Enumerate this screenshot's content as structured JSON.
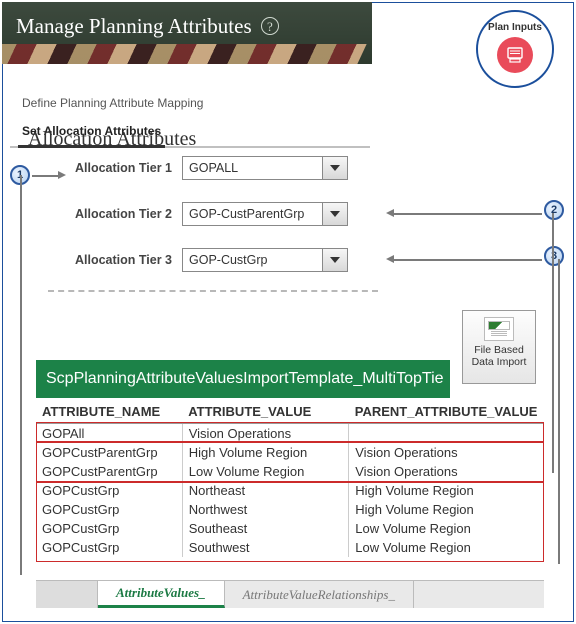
{
  "banner": {
    "title": "Manage Planning Attributes"
  },
  "plan_inputs": {
    "label": "Plan Inputs"
  },
  "tabs": [
    {
      "label": "Define Planning Attribute Mapping",
      "active": false
    },
    {
      "label": "Set Allocation Attributes",
      "active": true
    }
  ],
  "section_heading": "Allocation Attributes",
  "tiers": [
    {
      "label": "Allocation Tier 1",
      "value": "GOPALL"
    },
    {
      "label": "Allocation Tier 2",
      "value": "GOP-CustParentGrp"
    },
    {
      "label": "Allocation Tier 3",
      "value": "GOP-CustGrp"
    }
  ],
  "callouts": {
    "c1": "1",
    "c2": "2",
    "c3": "3"
  },
  "fbdi": {
    "line1": "File Based",
    "line2": "Data Import"
  },
  "template_title": "ScpPlanningAttributeValuesImportTemplate_MultiTopTie",
  "table": {
    "headers": [
      "ATTRIBUTE_NAME",
      "ATTRIBUTE_VALUE",
      "PARENT_ATTRIBUTE_VALUE"
    ],
    "rows": [
      [
        "GOPAll",
        "Vision Operations",
        ""
      ],
      [
        "GOPCustParentGrp",
        "High Volume Region",
        "Vision Operations"
      ],
      [
        "GOPCustParentGrp",
        "Low Volume Region",
        "Vision Operations"
      ],
      [
        "GOPCustGrp",
        "Northeast",
        "High Volume Region"
      ],
      [
        "GOPCustGrp",
        "Northwest",
        "High Volume Region"
      ],
      [
        "GOPCustGrp",
        "Southeast",
        "Low Volume Region"
      ],
      [
        "GOPCustGrp",
        "Southwest",
        "Low Volume Region"
      ]
    ]
  },
  "sheet_tabs": {
    "active": "AttributeValues_",
    "inactive": "AttributeValueRelationships_"
  }
}
